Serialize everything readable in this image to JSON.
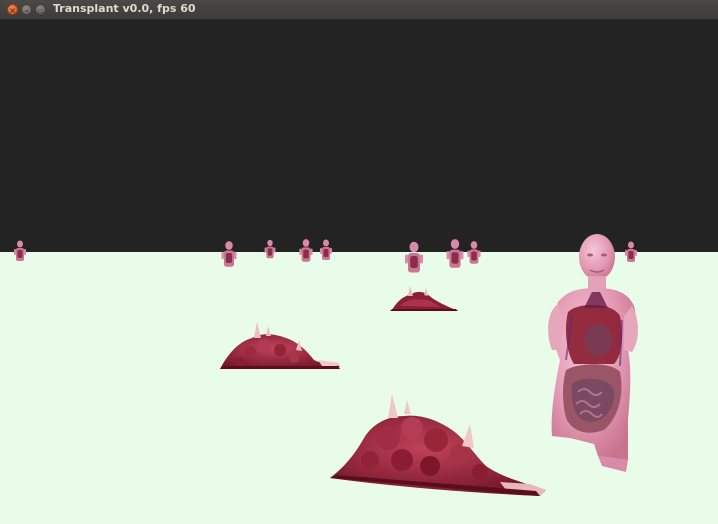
{
  "window": {
    "title": "Transplant v0.0, fps 60"
  },
  "colors": {
    "sky": "#232323",
    "ground": "#e9fbe9",
    "flesh": "#e7a9be",
    "organ": "#8c1f33"
  }
}
